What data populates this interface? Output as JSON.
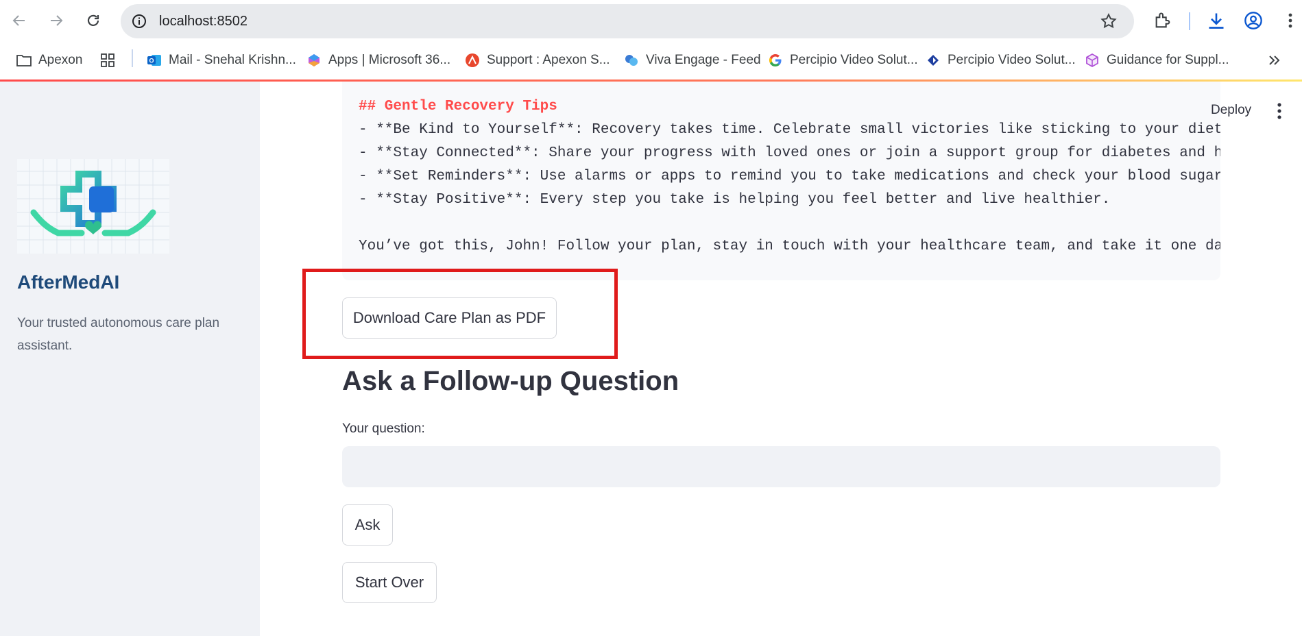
{
  "browser": {
    "url": "localhost:8502",
    "bookmarks": [
      {
        "label": "Apexon",
        "icon": "folder-icon"
      },
      {
        "label": "",
        "icon": "apps-grid-icon"
      },
      {
        "label": "Mail - Snehal Krishn...",
        "icon": "outlook-icon"
      },
      {
        "label": "Apps | Microsoft 36...",
        "icon": "microsoft365-icon"
      },
      {
        "label": "Support : Apexon S...",
        "icon": "support-icon"
      },
      {
        "label": "Viva Engage - Feed",
        "icon": "viva-engage-icon"
      },
      {
        "label": "Percipio Video Solut...",
        "icon": "google-icon"
      },
      {
        "label": "Percipio Video Solut...",
        "icon": "percipio-icon"
      },
      {
        "label": "Guidance for Suppl...",
        "icon": "cube-icon"
      }
    ]
  },
  "sidebar": {
    "app_title": "AfterMedAI",
    "description": "Your trusted autonomous care plan assistant."
  },
  "header": {
    "deploy_label": "Deploy"
  },
  "care_plan": {
    "lines": [
      "## Gentle Recovery Tips",
      "- **Be Kind to Yourself**: Recovery takes time. Celebrate small victories like sticking to your diet",
      "- **Stay Connected**: Share your progress with loved ones or join a support group for diabetes and h",
      "- **Set Reminders**: Use alarms or apps to remind you to take medications and check your blood sugar",
      "- **Stay Positive**: Every step you take is helping you feel better and live healthier.",
      "",
      "You’ve got this, John! Follow your plan, stay in touch with your healthcare team, and take it one da"
    ]
  },
  "actions": {
    "download_label": "Download Care Plan as PDF",
    "followup_heading": "Ask a Follow-up Question",
    "question_label": "Your question:",
    "question_value": "",
    "ask_label": "Ask",
    "start_over_label": "Start Over"
  },
  "colors": {
    "accent": "#ff4b4b",
    "highlight_box": "#e01b1b",
    "title": "#1e4a7a"
  }
}
